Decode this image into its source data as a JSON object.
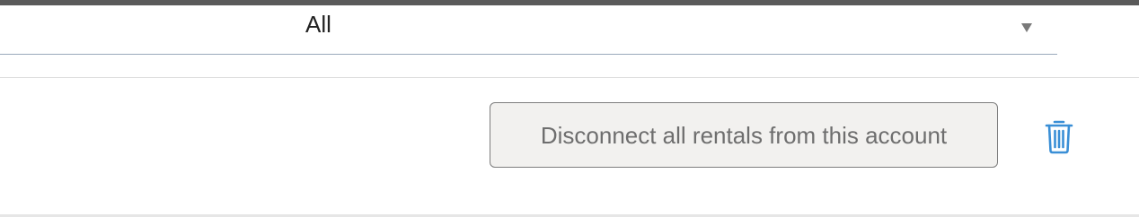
{
  "filters": {
    "status_select": {
      "value": "All"
    }
  },
  "actions": {
    "disconnect_label": "Disconnect all rentals from this account",
    "delete_icon": "trash-icon"
  },
  "colors": {
    "accent": "#3a8fd6",
    "top_bar": "#5a5a5a",
    "button_bg": "#f2f1ef",
    "button_border": "#7d7d7d",
    "input_underline": "#9aa9bb"
  }
}
